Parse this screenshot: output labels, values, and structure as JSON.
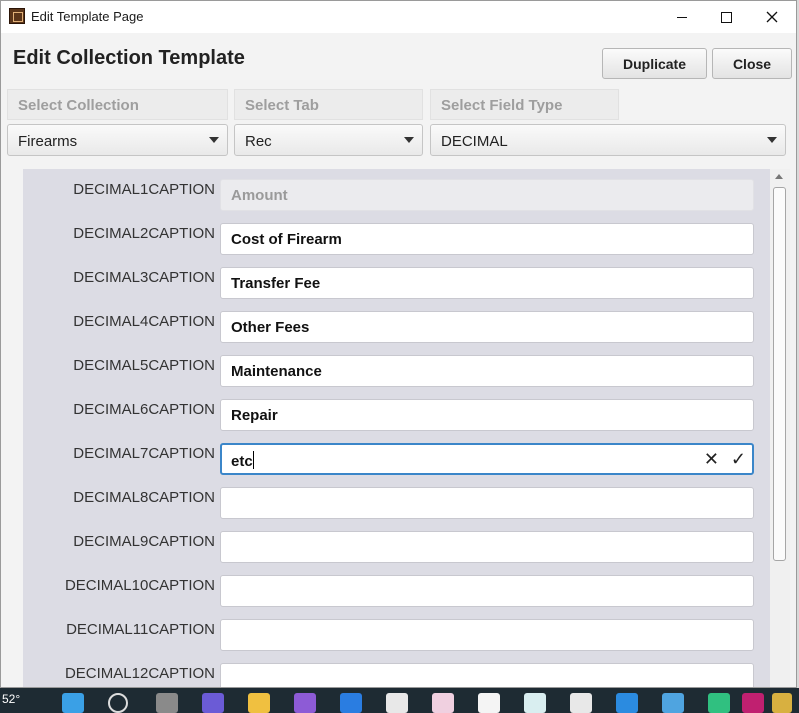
{
  "window": {
    "title": "Edit Template Page"
  },
  "page": {
    "title": "Edit Collection Template"
  },
  "buttons": {
    "duplicate": "Duplicate",
    "close": "Close"
  },
  "selectors": {
    "collection_header": "Select Collection",
    "tab_header": "Select Tab",
    "field_type_header": "Select Field Type",
    "collection_value": "Firearms",
    "tab_value": "Rec",
    "field_type_value": "DECIMAL"
  },
  "fields": [
    {
      "label": "DECIMAL1CAPTION",
      "value": "Amount"
    },
    {
      "label": "DECIMAL2CAPTION",
      "value": "Cost of Firearm"
    },
    {
      "label": "DECIMAL3CAPTION",
      "value": "Transfer Fee"
    },
    {
      "label": "DECIMAL4CAPTION",
      "value": "Other Fees"
    },
    {
      "label": "DECIMAL5CAPTION",
      "value": "Maintenance"
    },
    {
      "label": "DECIMAL6CAPTION",
      "value": "Repair"
    },
    {
      "label": "DECIMAL7CAPTION",
      "value": "etc"
    },
    {
      "label": "DECIMAL8CAPTION",
      "value": ""
    },
    {
      "label": "DECIMAL9CAPTION",
      "value": ""
    },
    {
      "label": "DECIMAL10CAPTION",
      "value": ""
    },
    {
      "label": "DECIMAL11CAPTION",
      "value": ""
    },
    {
      "label": "DECIMAL12CAPTION",
      "value": ""
    }
  ],
  "editor_actions": {
    "cancel_icon": "✕",
    "confirm_icon": "✓"
  },
  "taskbar": {
    "temperature": "52°"
  },
  "icons": {
    "app": "app-icon",
    "minimize": "minimize-icon",
    "maximize": "maximize-icon",
    "close": "close-icon",
    "dropdown": "chevron-down-icon"
  },
  "colors": {
    "focus_border": "#3b86c9",
    "panel_bg": "#dcdce4",
    "taskbar_bg": "#1e2b33"
  }
}
